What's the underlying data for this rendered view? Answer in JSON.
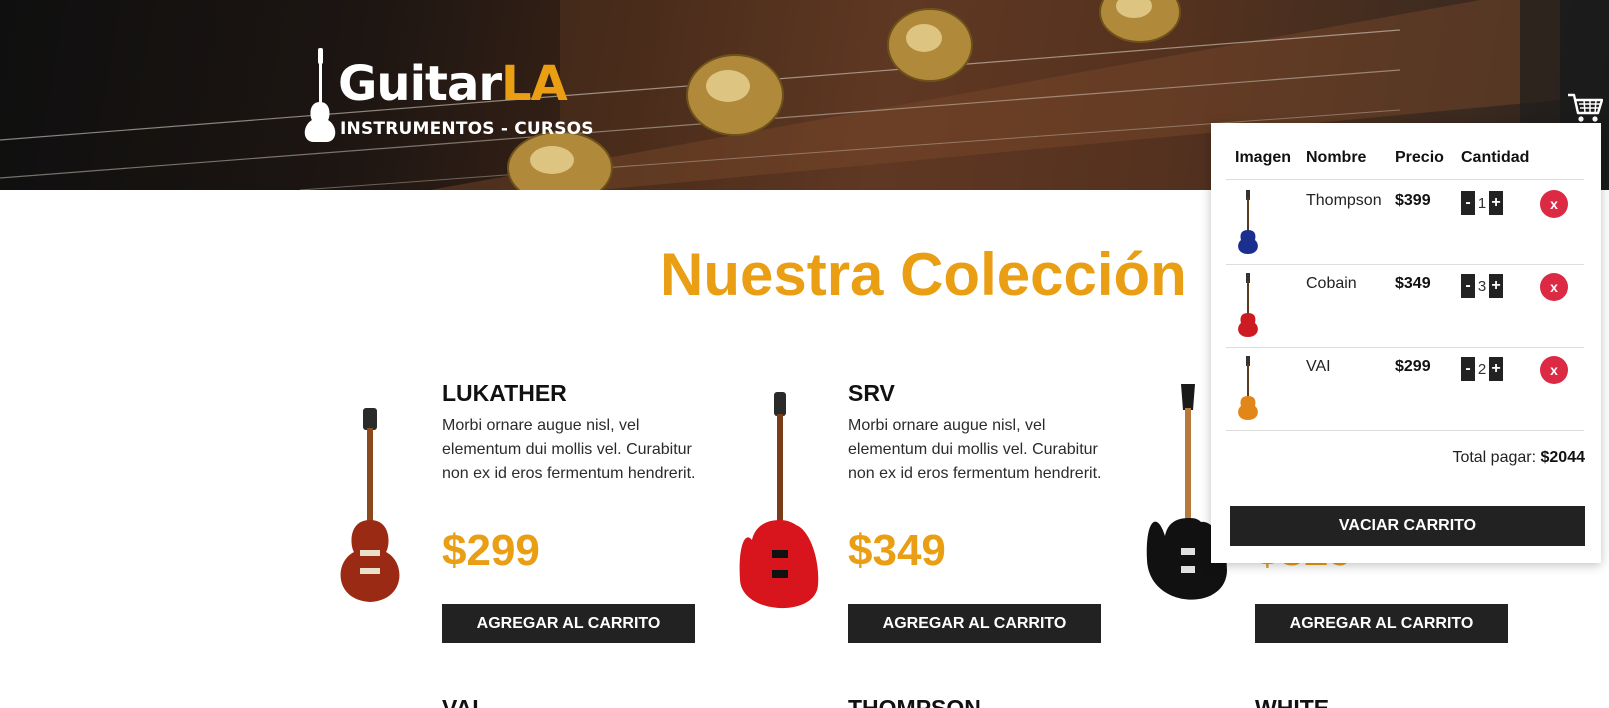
{
  "header": {
    "logo_word_1": "Guitar",
    "logo_word_2": "LA",
    "logo_tagline": "INSTRUMENTOS - CURSOS"
  },
  "main": {
    "title": "Nuestra Colección"
  },
  "products": [
    {
      "name": "LUKATHER",
      "desc": "Morbi ornare augue nisl, vel elementum dui mollis vel. Curabitur non ex id eros fermentum hendrerit.",
      "price": "$299",
      "button": "AGREGAR AL CARRITO",
      "body_color": "#9a2a14"
    },
    {
      "name": "SRV",
      "desc": "Morbi ornare augue nisl, vel elementum dui mollis vel. Curabitur non ex id eros fermentum hendrerit.",
      "price": "$349",
      "button": "AGREGAR AL CARRITO",
      "body_color": "#d8141c"
    },
    {
      "name": "",
      "desc": "",
      "price": "$329",
      "button": "AGREGAR AL CARRITO",
      "body_color": "#111111"
    }
  ],
  "products_row2": [
    {
      "name": "VAI"
    },
    {
      "name": "THOMPSON"
    },
    {
      "name": "WHITE"
    }
  ],
  "cart": {
    "headers": [
      "Imagen",
      "Nombre",
      "Precio",
      "Cantidad"
    ],
    "items": [
      {
        "name": "Thompson",
        "price": "$399",
        "qty": "1",
        "minus": "-",
        "plus": "+",
        "remove": "x",
        "body_color": "#1b2f8f"
      },
      {
        "name": "Cobain",
        "price": "$349",
        "qty": "3",
        "minus": "-",
        "plus": "+",
        "remove": "x",
        "body_color": "#cc1b22"
      },
      {
        "name": "VAI",
        "price": "$299",
        "qty": "2",
        "minus": "-",
        "plus": "+",
        "remove": "x",
        "body_color": "#e2861a"
      }
    ],
    "total_label": "Total pagar:",
    "total_value": "$2044",
    "empty_button": "VACIAR CARRITO"
  },
  "colors": {
    "accent": "#e99e13",
    "dark": "#222222",
    "remove": "#dc2a45"
  }
}
